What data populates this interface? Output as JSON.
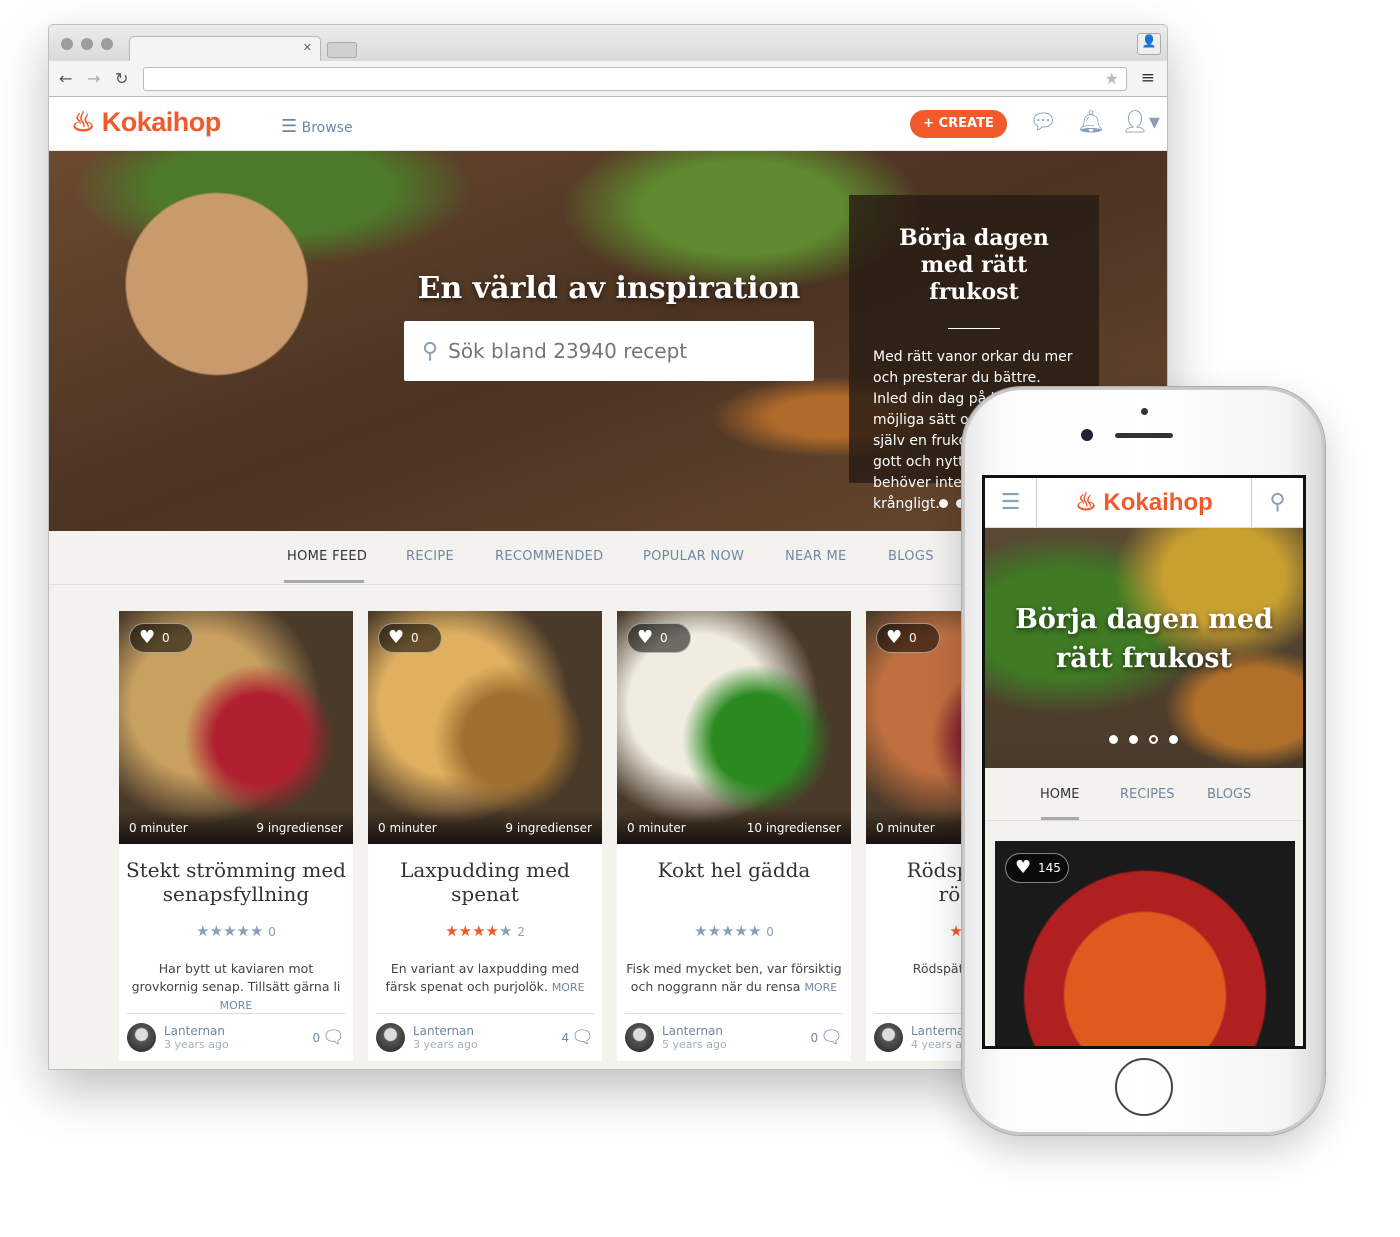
{
  "browser": {
    "address": ""
  },
  "site": {
    "logo": "Kokaihop",
    "browse": "Browse",
    "create": "+ CREATE"
  },
  "hero": {
    "title": "En värld av inspiration",
    "search_placeholder": "Sök bland 23940 recept",
    "promo_title": "Börja dagen med rätt frukost",
    "promo_text": "Med rätt vanor orkar du mer och presterar du bättre. Inled din dag på bästa möjliga sätt och unna dig själv en frukost som både är gott och nyttigt. Att äta rätt behöver inte vara dyrt eller krångligt."
  },
  "tabs": [
    {
      "label": "HOME FEED",
      "active": true
    },
    {
      "label": "RECIPE"
    },
    {
      "label": "RECOMMENDED"
    },
    {
      "label": "POPULAR NOW"
    },
    {
      "label": "NEAR ME"
    },
    {
      "label": "BLOGS"
    }
  ],
  "cards": [
    {
      "likes": "0",
      "time": "0 minuter",
      "ingredients": "9 ingredienser",
      "title": "Stekt strömming med senapsfyllning",
      "rating": 0,
      "rating_count": "0",
      "desc": "Har bytt ut kaviaren mot grovkornig senap. Tillsätt gärna li",
      "more": "MORE",
      "author": "Lanternan",
      "ago": "3 years ago",
      "comments": "0",
      "colors": [
        "#c8a060",
        "#b02030"
      ]
    },
    {
      "likes": "0",
      "time": "0 minuter",
      "ingredients": "9 ingredienser",
      "title": "Laxpudding med spenat",
      "rating": 3.5,
      "rating_count": "2",
      "desc": "En variant av laxpudding med färsk spenat och purjolök.",
      "more": "MORE",
      "author": "Lanternan",
      "ago": "3 years ago",
      "comments": "4",
      "colors": [
        "#e0b060",
        "#a07030"
      ]
    },
    {
      "likes": "0",
      "time": "0 minuter",
      "ingredients": "10 ingredienser",
      "title": "Kokt hel gädda",
      "rating": 0,
      "rating_count": "0",
      "desc": "Fisk med mycket ben, var försiktig och noggrann när du rensa",
      "more": "MORE",
      "author": "Lanternan",
      "ago": "5 years ago",
      "comments": "0",
      "colors": [
        "#f0ece0",
        "#2a8a20"
      ]
    },
    {
      "likes": "0",
      "time": "0 minuter",
      "ingredients": "",
      "title": "Rödspätta med rödbetor",
      "rating": 2,
      "rating_count": "",
      "desc": "Rödspätta Grenoble), i",
      "more": "",
      "author": "Lanternan",
      "ago": "4 years ago",
      "comments": "",
      "colors": [
        "#c07040",
        "#802030"
      ]
    }
  ],
  "phone": {
    "logo": "Kokaihop",
    "hero_title": "Börja dagen med rätt frukost",
    "tabs": [
      "HOME",
      "RECIPES",
      "BLOGS"
    ],
    "card_likes": "145"
  },
  "colors": {
    "accent": "#f15a2b",
    "link": "#6f88a2"
  }
}
